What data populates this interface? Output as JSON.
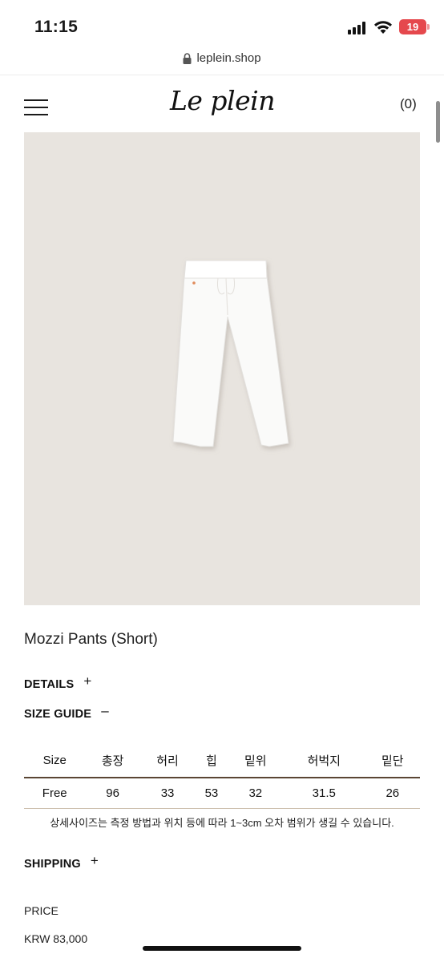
{
  "status_bar": {
    "time": "11:15",
    "battery": "19",
    "battery_color": "#e5484d"
  },
  "browser": {
    "url": "leplein.shop",
    "lock_icon": "lock-icon"
  },
  "header": {
    "logo": "Le plein",
    "cart": "(0)",
    "menu_icon": "hamburger-menu-icon"
  },
  "product": {
    "title": "Mozzi Pants (Short)",
    "image_bg": "#e8e4df"
  },
  "sections": {
    "details": {
      "label": "DETAILS",
      "toggle": "+"
    },
    "size_guide": {
      "label": "SIZE GUIDE",
      "toggle": "–"
    },
    "shipping": {
      "label": "SHIPPING",
      "toggle": "+"
    }
  },
  "size_table": {
    "headers": [
      "Size",
      "총장",
      "허리",
      "힙",
      "밑위",
      "허벅지",
      "밑단"
    ],
    "rows": [
      [
        "Free",
        "96",
        "33",
        "53",
        "32",
        "31.5",
        "26"
      ]
    ],
    "note": "상세사이즈는 측정 방법과 위치 등에 따라 1~3cm 오차 범위가 생길 수 있습니다."
  },
  "price": {
    "label": "PRICE",
    "value": "KRW 83,000"
  }
}
